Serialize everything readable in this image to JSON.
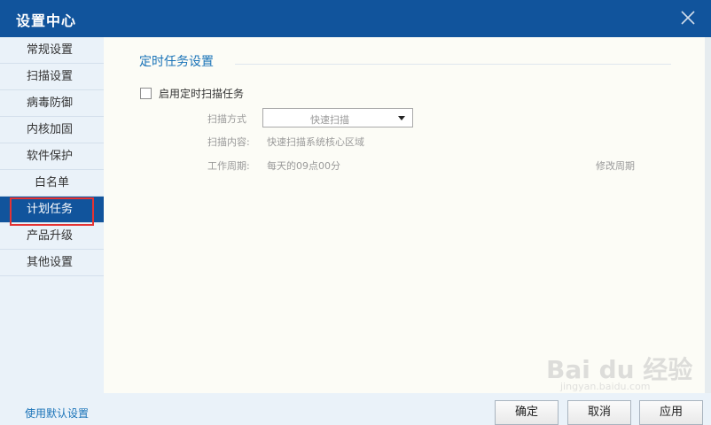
{
  "window": {
    "title": "设置中心"
  },
  "sidebar": {
    "items": [
      {
        "label": "常规设置"
      },
      {
        "label": "扫描设置"
      },
      {
        "label": "病毒防御"
      },
      {
        "label": "内核加固"
      },
      {
        "label": "软件保护"
      },
      {
        "label": "白名单"
      },
      {
        "label": "计划任务"
      },
      {
        "label": "产品升级"
      },
      {
        "label": "其他设置"
      }
    ],
    "active_index": 6
  },
  "section": {
    "title": "定时任务设置",
    "enable_label": "启用定时扫描任务",
    "scan_mode_label": "扫描方式",
    "scan_mode_value": "快速扫描",
    "scan_content_label": "扫描内容:",
    "scan_content_value": "快速扫描系统核心区域",
    "work_cycle_label": "工作周期:",
    "work_cycle_value": "每天的09点00分",
    "modify_cycle": "修改周期"
  },
  "footer": {
    "default_link": "使用默认设置",
    "ok": "确定",
    "cancel": "取消",
    "apply": "应用"
  },
  "watermark": {
    "text": "Bai du 经验",
    "sub": "jingyan.baidu.com"
  },
  "colors": {
    "titlebar": "#11549c",
    "accent": "#1a73b8",
    "highlight": "#e53333"
  }
}
